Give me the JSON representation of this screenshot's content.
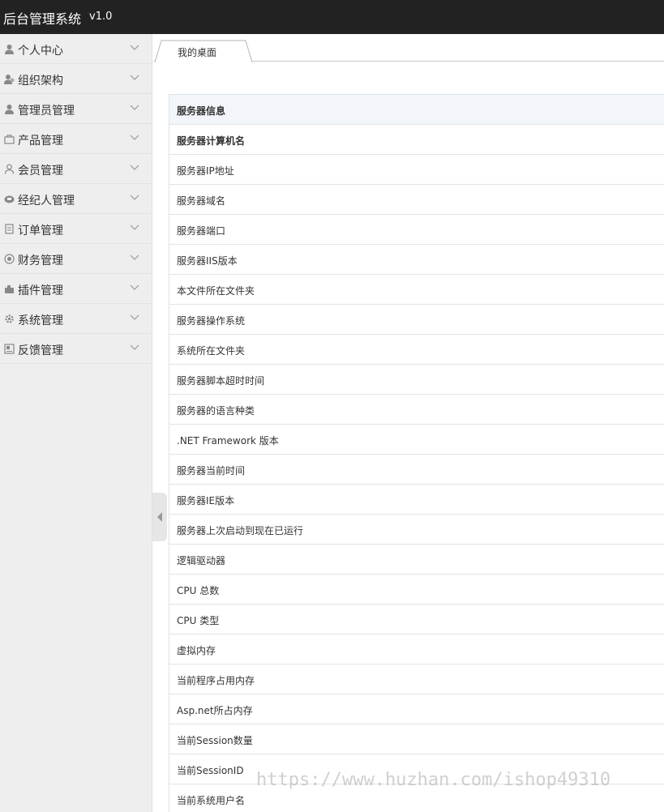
{
  "header": {
    "title": "后台管理系统",
    "version": "v1.0"
  },
  "sidebar": {
    "items": [
      {
        "label": "个人中心",
        "icon": "user-icon"
      },
      {
        "label": "组织架构",
        "icon": "org-icon"
      },
      {
        "label": "管理员管理",
        "icon": "admin-icon"
      },
      {
        "label": "产品管理",
        "icon": "bag-icon"
      },
      {
        "label": "会员管理",
        "icon": "member-icon"
      },
      {
        "label": "经纪人管理",
        "icon": "agent-icon"
      },
      {
        "label": "订单管理",
        "icon": "order-icon"
      },
      {
        "label": "财务管理",
        "icon": "finance-icon"
      },
      {
        "label": "插件管理",
        "icon": "plugin-icon"
      },
      {
        "label": "系统管理",
        "icon": "gear-icon"
      },
      {
        "label": "反馈管理",
        "icon": "feedback-icon"
      }
    ]
  },
  "tabs": [
    {
      "label": "我的桌面"
    }
  ],
  "table": {
    "header": "服务器信息",
    "rows": [
      "服务器计算机名",
      "服务器IP地址",
      "服务器域名",
      "服务器端口",
      "服务器IIS版本",
      "本文件所在文件夹",
      "服务器操作系统",
      "系统所在文件夹",
      "服务器脚本超时时间",
      "服务器的语言种类",
      ".NET Framework 版本",
      "服务器当前时间",
      "服务器IE版本",
      "服务器上次启动到现在已运行",
      "逻辑驱动器",
      "CPU 总数",
      "CPU 类型",
      "虚拟内存",
      "当前程序占用内存",
      "Asp.net所占内存",
      "当前Session数量",
      "当前SessionID",
      "当前系统用户名"
    ]
  },
  "watermark": "https://www.huzhan.com/ishop49310",
  "colors": {
    "topbar": "#222222",
    "sidebar": "#eeeeee",
    "table_head": "#f2f6fa"
  }
}
